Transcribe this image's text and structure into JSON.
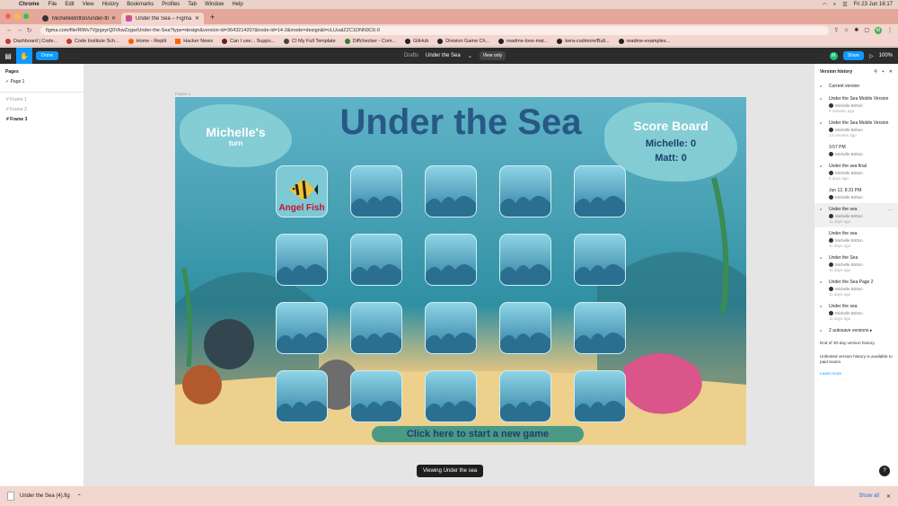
{
  "menubar": {
    "app": "Chrome",
    "items": [
      "File",
      "Edit",
      "View",
      "History",
      "Bookmarks",
      "Profiles",
      "Tab",
      "Window",
      "Help"
    ],
    "datetime": "Fri 23 Jun  16:17"
  },
  "tabs": [
    {
      "label": "MichelleBritton/under-the-sea"
    },
    {
      "label": "Under the Sea – Figma"
    }
  ],
  "address": {
    "url": "figma.com/file/RlWv7VjjrgxyrQ0VkwZzgw/Under-the-Sea?type=design&version-id=3643214207&node-id=14-2&mode=design&t=cLUualZZC1DNN3C6-0"
  },
  "bookmarks": [
    "Dashboard | Code...",
    "Code Institute Sch...",
    "Home - Replit",
    "Hacker News",
    "Can I use... Suppo...",
    "CI My Full Template",
    "Diffchecker - Com...",
    "GitHub",
    "Division Game Ch...",
    "readme-love-mat...",
    "kera-cudmore/Bull...",
    "readme-examples..."
  ],
  "figma": {
    "done": "Done",
    "drafts": "Drafts",
    "file_title": "Under the Sea",
    "view_only": "View only",
    "share": "Share",
    "zoom": "100%",
    "user_initial": "M"
  },
  "pages_panel": {
    "title": "Pages",
    "page": "Page 1",
    "layers": [
      "Frame 1",
      "Frame 2",
      "Frame 3"
    ]
  },
  "canvas": {
    "frame_label": "Frame 3",
    "game_title": "Under the Sea",
    "turn_name": "Michelle's",
    "turn_sub": "turn",
    "score_title": "Score Board",
    "score_michelle": "Michelle: 0",
    "score_matt": "Matt: 0",
    "revealed_card": "Angel Fish",
    "new_game": "Click here to start a new game",
    "viewing": "Viewing Under the sea"
  },
  "version_history": {
    "title": "Version history",
    "current": "Current version",
    "versions": [
      {
        "title": "Under the Sea Mobile Version",
        "user": "Michelle Britton",
        "when": "8 minutes ago"
      },
      {
        "title": "Under the Sea Mobile Version",
        "user": "Michelle Britton",
        "when": "13 minutes ago"
      },
      {
        "title": "3:57 PM",
        "user": "Michelle Britton",
        "when": ""
      },
      {
        "title": "Under the sea final",
        "user": "Michelle Britton",
        "when": "5 days ago"
      },
      {
        "title": "Jun 12, 8:31 PM",
        "user": "Michelle Britton",
        "when": ""
      },
      {
        "title": "Under the sea",
        "user": "Michelle Britton",
        "when": "11 days ago"
      },
      {
        "title": "Under the sea",
        "user": "Michelle Britton",
        "when": "11 days ago"
      },
      {
        "title": "Under the Sea",
        "user": "Michelle Britton",
        "when": "11 days ago"
      },
      {
        "title": "Under the Sea Page 2",
        "user": "Michelle Britton",
        "when": "11 days ago"
      },
      {
        "title": "Under the sea",
        "user": "Michelle Britton",
        "when": "11 days ago"
      }
    ],
    "autosave": "2 autosave versions",
    "end_note": "End of 30-day version history.",
    "paid_note": "Unlimited version history is available to paid teams.",
    "learn_more": "Learn more"
  },
  "downloads": {
    "file": "Under the Sea (4).fig",
    "show_all": "Show all"
  }
}
